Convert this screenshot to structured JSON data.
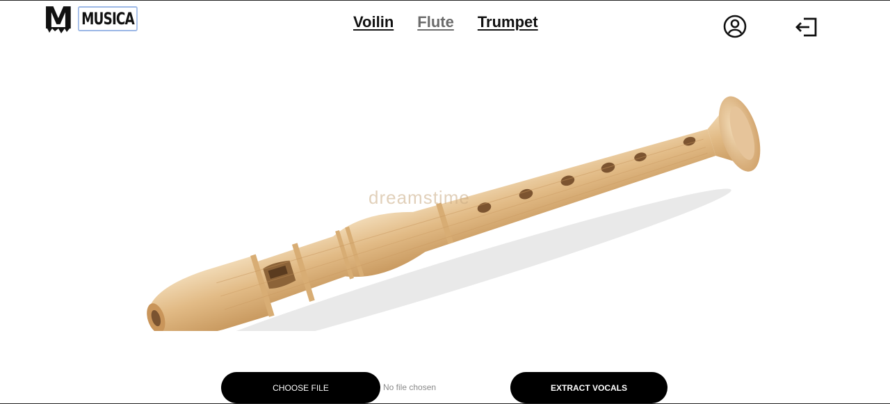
{
  "brand": {
    "mark": "M",
    "name": "MUSICA"
  },
  "nav": [
    {
      "label": "Voilin",
      "active": false
    },
    {
      "label": "Flute",
      "active": true
    },
    {
      "label": "Trumpet",
      "active": false
    }
  ],
  "icons": {
    "account": "user-circle-icon",
    "logout": "logout-icon"
  },
  "hero": {
    "watermark": "dreamstime"
  },
  "upload": {
    "choose_label": "CHOOSE FILE",
    "file_status": "No file chosen",
    "extract_label": "EXTRACT VOCALS"
  },
  "colors": {
    "button_bg": "#000000",
    "active_nav": "#6b6b6b",
    "logo_border": "#9bb7e6"
  }
}
